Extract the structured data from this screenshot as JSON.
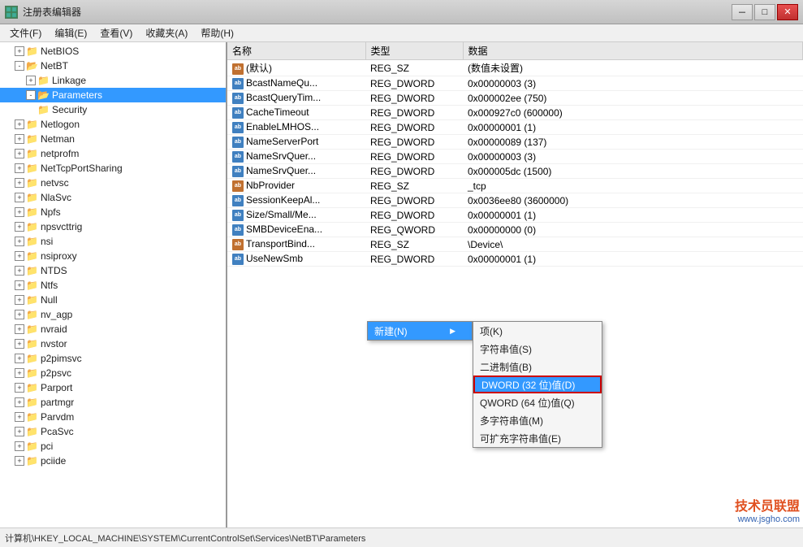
{
  "window": {
    "title": "注册表编辑器",
    "icon": "🗂"
  },
  "titlebar": {
    "minimize": "－",
    "maximize": "□",
    "close": "✕"
  },
  "menubar": {
    "items": [
      {
        "label": "文件(F)"
      },
      {
        "label": "编辑(E)"
      },
      {
        "label": "查看(V)"
      },
      {
        "label": "收藏夹(A)"
      },
      {
        "label": "帮助(H)"
      }
    ]
  },
  "tree": {
    "items": [
      {
        "id": "netbios",
        "label": "NetBIOS",
        "level": 1,
        "expanded": false,
        "hasChildren": true
      },
      {
        "id": "netbt",
        "label": "NetBT",
        "level": 1,
        "expanded": true,
        "hasChildren": true,
        "selected": false
      },
      {
        "id": "linkage",
        "label": "Linkage",
        "level": 2,
        "expanded": false,
        "hasChildren": true
      },
      {
        "id": "parameters",
        "label": "Parameters",
        "level": 2,
        "expanded": true,
        "hasChildren": true,
        "selected": true
      },
      {
        "id": "security",
        "label": "Security",
        "level": 3,
        "expanded": false,
        "hasChildren": false
      },
      {
        "id": "netlogon",
        "label": "Netlogon",
        "level": 1,
        "expanded": false,
        "hasChildren": true
      },
      {
        "id": "netman",
        "label": "Netman",
        "level": 1,
        "expanded": false,
        "hasChildren": true
      },
      {
        "id": "netprofm",
        "label": "netprofm",
        "level": 1,
        "expanded": false,
        "hasChildren": true
      },
      {
        "id": "nettcpportsharing",
        "label": "NetTcpPortSharing",
        "level": 1,
        "expanded": false,
        "hasChildren": true
      },
      {
        "id": "netvsc",
        "label": "netvsc",
        "level": 1,
        "expanded": false,
        "hasChildren": true
      },
      {
        "id": "nlasvc",
        "label": "NlaSvc",
        "level": 1,
        "expanded": false,
        "hasChildren": true
      },
      {
        "id": "npfs",
        "label": "Npfs",
        "level": 1,
        "expanded": false,
        "hasChildren": true
      },
      {
        "id": "npsvcttrig",
        "label": "npsvcttrig",
        "level": 1,
        "expanded": false,
        "hasChildren": true
      },
      {
        "id": "nsi",
        "label": "nsi",
        "level": 1,
        "expanded": false,
        "hasChildren": true
      },
      {
        "id": "nsiproxy",
        "label": "nsiproxy",
        "level": 1,
        "expanded": false,
        "hasChildren": true
      },
      {
        "id": "ntds",
        "label": "NTDS",
        "level": 1,
        "expanded": false,
        "hasChildren": true
      },
      {
        "id": "ntfs",
        "label": "Ntfs",
        "level": 1,
        "expanded": false,
        "hasChildren": true
      },
      {
        "id": "null",
        "label": "Null",
        "level": 1,
        "expanded": false,
        "hasChildren": true
      },
      {
        "id": "nv_agp",
        "label": "nv_agp",
        "level": 1,
        "expanded": false,
        "hasChildren": true
      },
      {
        "id": "nvraid",
        "label": "nvraid",
        "level": 1,
        "expanded": false,
        "hasChildren": true
      },
      {
        "id": "nvstor",
        "label": "nvstor",
        "level": 1,
        "expanded": false,
        "hasChildren": true
      },
      {
        "id": "p2pimsvc",
        "label": "p2pimsvc",
        "level": 1,
        "expanded": false,
        "hasChildren": true
      },
      {
        "id": "p2psvc",
        "label": "p2psvc",
        "level": 1,
        "expanded": false,
        "hasChildren": true
      },
      {
        "id": "parport",
        "label": "Parport",
        "level": 1,
        "expanded": false,
        "hasChildren": true
      },
      {
        "id": "partmgr",
        "label": "partmgr",
        "level": 1,
        "expanded": false,
        "hasChildren": true
      },
      {
        "id": "parvdm",
        "label": "Parvdm",
        "level": 1,
        "expanded": false,
        "hasChildren": true
      },
      {
        "id": "pcasvc",
        "label": "PcaSvc",
        "level": 1,
        "expanded": false,
        "hasChildren": true
      },
      {
        "id": "pci",
        "label": "pci",
        "level": 1,
        "expanded": false,
        "hasChildren": true
      },
      {
        "id": "pciide",
        "label": "pciide",
        "level": 1,
        "expanded": false,
        "hasChildren": true
      }
    ]
  },
  "registry": {
    "columns": [
      "名称",
      "类型",
      "数据"
    ],
    "rows": [
      {
        "name": "(默认)",
        "type": "REG_SZ",
        "data": "(数值未设置)",
        "icon": "ab"
      },
      {
        "name": "BcastNameQu...",
        "type": "REG_DWORD",
        "data": "0x00000003 (3)",
        "icon": "dword"
      },
      {
        "name": "BcastQueryTim...",
        "type": "REG_DWORD",
        "data": "0x000002ee (750)",
        "icon": "dword"
      },
      {
        "name": "CacheTimeout",
        "type": "REG_DWORD",
        "data": "0x000927c0 (600000)",
        "icon": "dword"
      },
      {
        "name": "EnableLMHOS...",
        "type": "REG_DWORD",
        "data": "0x00000001 (1)",
        "icon": "dword"
      },
      {
        "name": "NameServerPort",
        "type": "REG_DWORD",
        "data": "0x00000089 (137)",
        "icon": "dword"
      },
      {
        "name": "NameSrvQuer...",
        "type": "REG_DWORD",
        "data": "0x00000003 (3)",
        "icon": "dword"
      },
      {
        "name": "NameSrvQuer...",
        "type": "REG_DWORD",
        "data": "0x000005dc (1500)",
        "icon": "dword"
      },
      {
        "name": "NbProvider",
        "type": "REG_SZ",
        "data": "_tcp",
        "icon": "ab"
      },
      {
        "name": "SessionKeepAl...",
        "type": "REG_DWORD",
        "data": "0x0036ee80 (3600000)",
        "icon": "dword"
      },
      {
        "name": "Size/Small/Me...",
        "type": "REG_DWORD",
        "data": "0x00000001 (1)",
        "icon": "dword"
      },
      {
        "name": "SMBDeviceEna...",
        "type": "REG_QWORD",
        "data": "0x00000000 (0)",
        "icon": "dword"
      },
      {
        "name": "TransportBind...",
        "type": "REG_SZ",
        "data": "\\Device\\",
        "icon": "ab"
      },
      {
        "name": "UseNewSmb",
        "type": "REG_DWORD",
        "data": "0x00000001 (1)",
        "icon": "dword"
      }
    ]
  },
  "context_menu": {
    "new_label": "新建(N)",
    "arrow": "▶",
    "submenu_items": [
      {
        "label": "项(K)"
      },
      {
        "label": "字符串值(S)"
      },
      {
        "label": "二进制值(B)"
      },
      {
        "label": "DWORD (32 位)值(D)",
        "highlighted": true
      },
      {
        "label": "QWORD (64 位)值(Q)"
      },
      {
        "label": "多字符串值(M)"
      },
      {
        "label": "可扩充字符串值(E)"
      }
    ]
  },
  "status_bar": {
    "text": "计算机\\HKEY_LOCAL_MACHINE\\SYSTEM\\CurrentControlSet\\Services\\NetBT\\Parameters"
  },
  "watermark": {
    "line1": "技术员联盟",
    "line2": "www.jsgho.com"
  }
}
